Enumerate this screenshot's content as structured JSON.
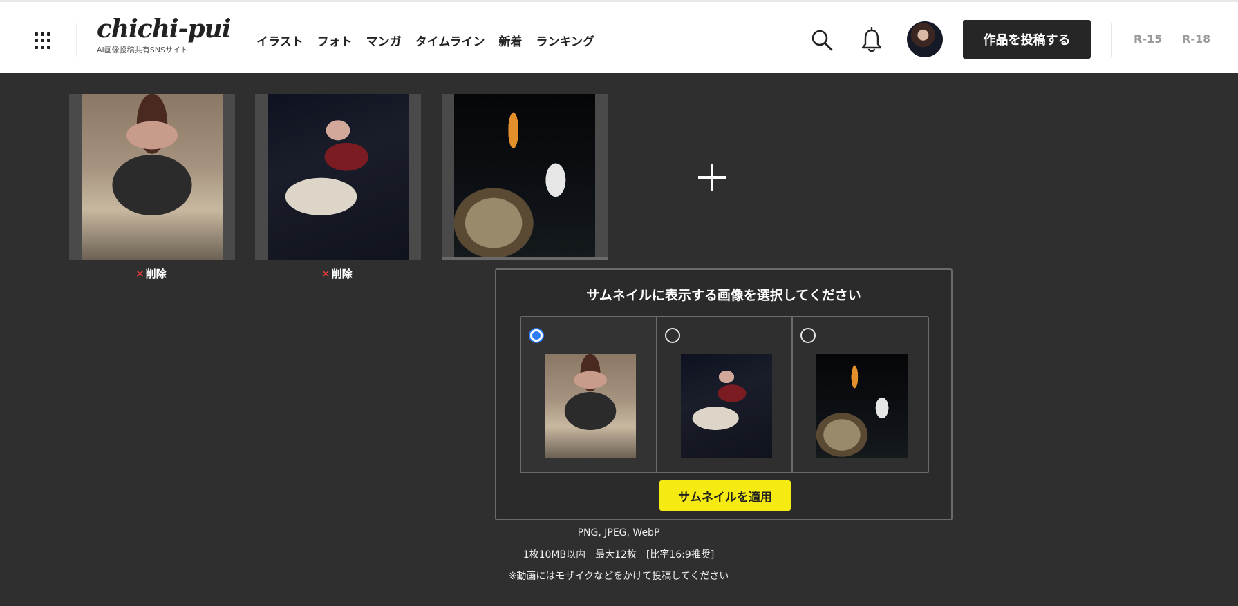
{
  "header": {
    "logo_main": "chichi-pui",
    "logo_sub": "AI画像投稿共有SNSサイト",
    "nav": [
      {
        "label": "イラスト"
      },
      {
        "label": "フォト"
      },
      {
        "label": "マンガ"
      },
      {
        "label": "タイムライン"
      },
      {
        "label": "新着"
      },
      {
        "label": "ランキング"
      }
    ],
    "post_button": "作品を投稿する",
    "rating_r15": "R-15",
    "rating_r18": "R-18"
  },
  "uploads": [
    {
      "image": "woman-black-top-sitting",
      "remove_label": "削除"
    },
    {
      "image": "woman-red-top-street-night",
      "remove_label": "削除"
    },
    {
      "image": "cat-and-tokyo-tower-night",
      "remove_label": ""
    }
  ],
  "thumbnail_modal": {
    "title": "サムネイルに表示する画像を選択してください",
    "options": [
      {
        "image": "woman-black-top-sitting",
        "selected": true
      },
      {
        "image": "woman-red-top-street-night",
        "selected": false
      },
      {
        "image": "cat-and-tokyo-tower-night",
        "selected": false
      }
    ],
    "apply_button": "サムネイルを適用"
  },
  "notes": {
    "formats": "PNG, JPEG, WebP",
    "limits": "1枚10MB以内　最大12枚　[比率16:9推奨]",
    "video_note": "※動画にはモザイクなどをかけて投稿してください"
  },
  "colors": {
    "background": "#2f2f2f",
    "header_bg": "#ffffff",
    "accent_yellow": "#f5ea12",
    "radio_selected": "#2d7cf6",
    "delete_x": "#ff3b3b"
  },
  "icons": [
    "apps-grid-icon",
    "search-icon",
    "bell-icon",
    "plus-icon",
    "close-x-icon"
  ]
}
